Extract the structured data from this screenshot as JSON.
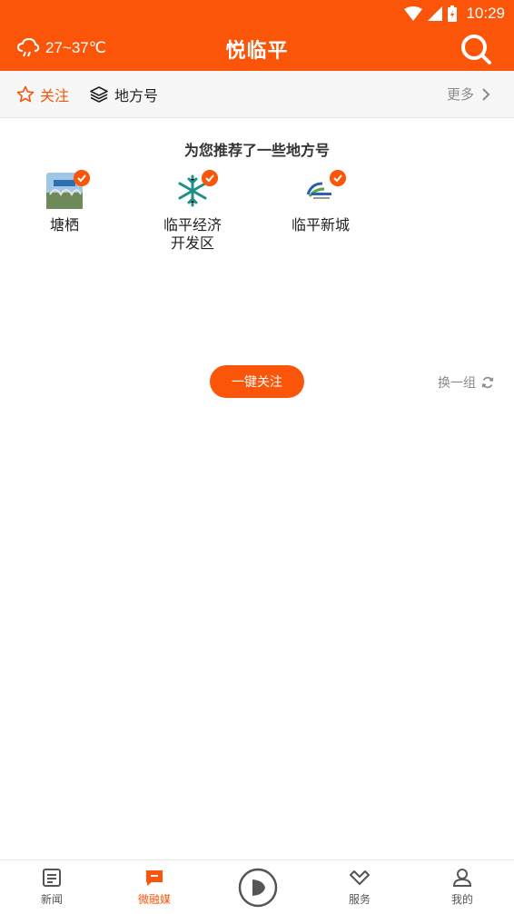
{
  "status_bar": {
    "time": "10:29"
  },
  "header": {
    "weather": "27~37℃",
    "title": "悦临平"
  },
  "tabs": {
    "follow_label": "关注",
    "local_label": "地方号",
    "more_label": "更多"
  },
  "recommend": {
    "title": "为您推荐了一些地方号",
    "accounts": [
      {
        "name": "塘栖",
        "selected": true
      },
      {
        "name": "临平经济\n开发区",
        "selected": true
      },
      {
        "name": "临平新城",
        "selected": true
      }
    ],
    "follow_all_label": "一键关注",
    "refresh_label": "换一组"
  },
  "bottom_nav": {
    "items": [
      {
        "label": "新闻"
      },
      {
        "label": "微融媒"
      },
      {
        "label": "服务"
      },
      {
        "label": "我的"
      }
    ],
    "active_label": "微融媒"
  },
  "colors": {
    "accent": "#fa5508"
  }
}
